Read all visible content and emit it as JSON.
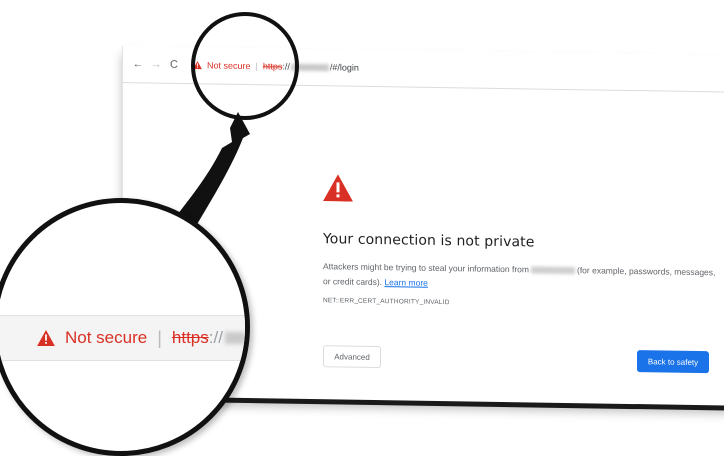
{
  "toolbar": {
    "back_icon": "←",
    "forward_icon": "→",
    "reload_icon": "C",
    "not_secure": "Not secure",
    "separator": "|",
    "scheme": "https",
    "scheme_sep": "://",
    "path": "/#/login"
  },
  "page": {
    "heading": "Your connection is not private",
    "body_part1": "Attackers might be trying to steal your information from",
    "body_part2": "(for example, passwords, messages, or credit cards).",
    "learn_more": "Learn more",
    "error_code": "NET::ERR_CERT_AUTHORITY_INVALID",
    "advanced_label": "Advanced",
    "back_to_safety_label": "Back to safety"
  },
  "zoom": {
    "not_secure": "Not secure",
    "separator": "|",
    "scheme": "https",
    "slashes": "://"
  },
  "colors": {
    "warning_red": "#d93025",
    "link_blue": "#1a73e8",
    "primary_button": "#1a73e8"
  }
}
